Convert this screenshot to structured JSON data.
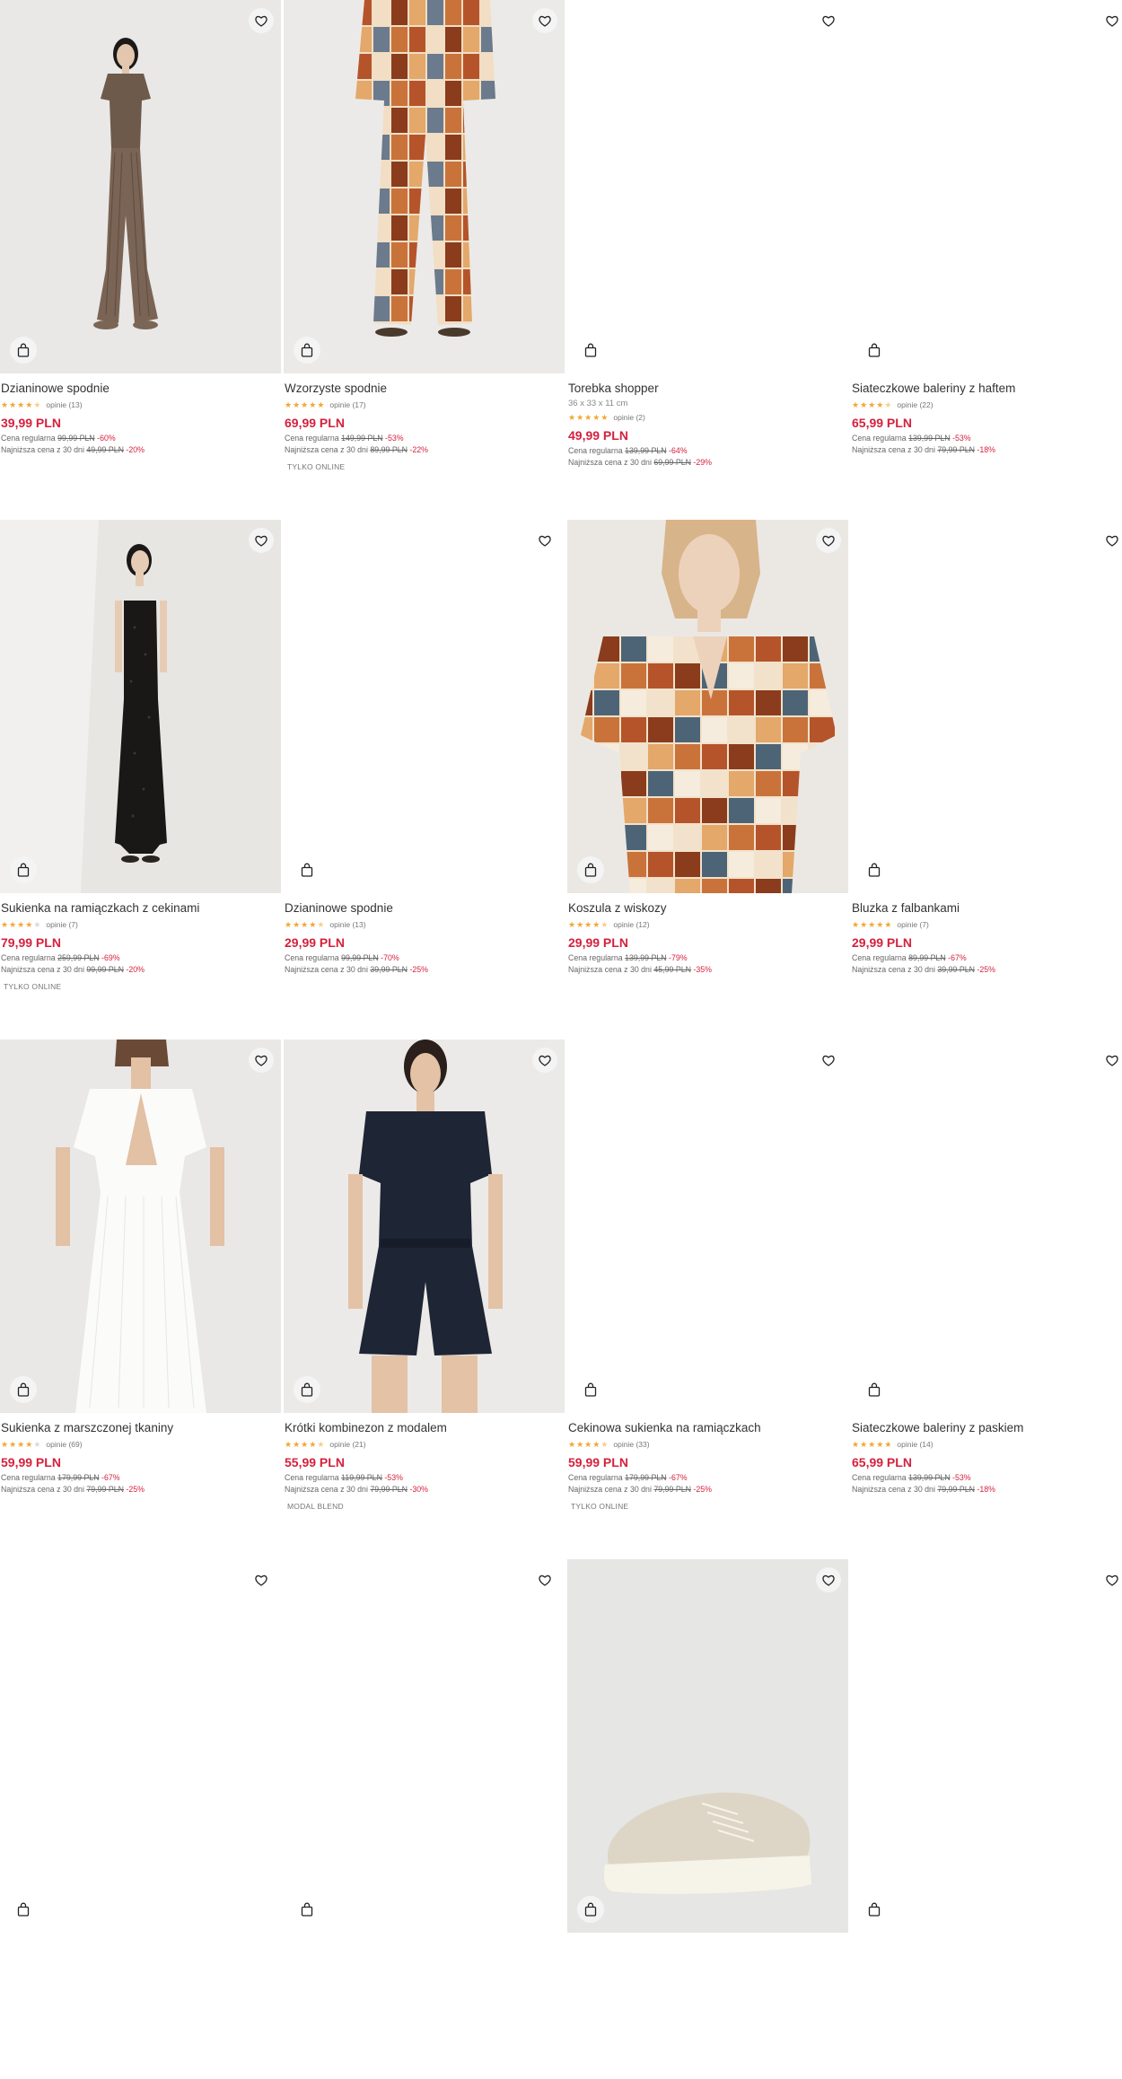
{
  "products": [
    {
      "name": "Dzianinowe spodnie",
      "dims": "",
      "stars": 4.5,
      "reviews": "opinie (13)",
      "price": "39,99 PLN",
      "reg_label": "Cena regularna",
      "reg_price": "99,99 PLN",
      "reg_disc": "-60%",
      "low_label": "Najniższa cena z 30 dni",
      "low_price": "49,99 PLN",
      "low_disc": "-20%",
      "tag": "",
      "image": "knit-brown-outfit",
      "fav_icon": "heart-outline-icon",
      "bag_icon": "shopping-bag-icon"
    },
    {
      "name": "Wzorzyste spodnie",
      "dims": "",
      "stars": 5,
      "reviews": "opinie (17)",
      "price": "69,99 PLN",
      "reg_label": "Cena regularna",
      "reg_price": "149,99 PLN",
      "reg_disc": "-53%",
      "low_label": "Najniższa cena z 30 dni",
      "low_price": "89,99 PLN",
      "low_disc": "-22%",
      "tag": "TYLKO ONLINE",
      "image": "patterned-trousers",
      "fav_icon": "heart-outline-icon",
      "bag_icon": "shopping-bag-icon"
    },
    {
      "name": "Torebka shopper",
      "dims": "36 x 33 x 11 cm",
      "stars": 5,
      "reviews": "opinie (2)",
      "price": "49,99 PLN",
      "reg_label": "Cena regularna",
      "reg_price": "139,99 PLN",
      "reg_disc": "-64%",
      "low_label": "Najniższa cena z 30 dni",
      "low_price": "69,99 PLN",
      "low_disc": "-29%",
      "tag": "",
      "image": "blank",
      "fav_icon": "heart-outline-icon",
      "bag_icon": "shopping-bag-icon"
    },
    {
      "name": "Siateczkowe baleriny z haftem",
      "dims": "",
      "stars": 4.5,
      "reviews": "opinie (22)",
      "price": "65,99 PLN",
      "reg_label": "Cena regularna",
      "reg_price": "139,99 PLN",
      "reg_disc": "-53%",
      "low_label": "Najniższa cena z 30 dni",
      "low_price": "79,99 PLN",
      "low_disc": "-18%",
      "tag": "",
      "image": "blank",
      "fav_icon": "heart-outline-icon",
      "bag_icon": "shopping-bag-icon"
    },
    {
      "name": "Sukienka na ramiączkach z cekinami",
      "dims": "",
      "stars": 4,
      "reviews": "opinie (7)",
      "price": "79,99 PLN",
      "reg_label": "Cena regularna",
      "reg_price": "259,99 PLN",
      "reg_disc": "-69%",
      "low_label": "Najniższa cena z 30 dni",
      "low_price": "99,99 PLN",
      "low_disc": "-20%",
      "tag": "TYLKO ONLINE",
      "image": "black-sequin-dress",
      "fav_icon": "heart-outline-icon",
      "bag_icon": "shopping-bag-icon"
    },
    {
      "name": "Dzianinowe spodnie",
      "dims": "",
      "stars": 4.5,
      "reviews": "opinie (13)",
      "price": "29,99 PLN",
      "reg_label": "Cena regularna",
      "reg_price": "99,99 PLN",
      "reg_disc": "-70%",
      "low_label": "Najniższa cena z 30 dni",
      "low_price": "39,99 PLN",
      "low_disc": "-25%",
      "tag": "",
      "image": "blank",
      "fav_icon": "heart-outline-icon",
      "bag_icon": "shopping-bag-icon"
    },
    {
      "name": "Koszula z wiskozy",
      "dims": "",
      "stars": 4.5,
      "reviews": "opinie (12)",
      "price": "29,99 PLN",
      "reg_label": "Cena regularna",
      "reg_price": "139,99 PLN",
      "reg_disc": "-79%",
      "low_label": "Najniższa cena z 30 dni",
      "low_price": "45,99 PLN",
      "low_disc": "-35%",
      "tag": "",
      "image": "patterned-shirt",
      "fav_icon": "heart-outline-icon",
      "bag_icon": "shopping-bag-icon"
    },
    {
      "name": "Bluzka z falbankami",
      "dims": "",
      "stars": 5,
      "reviews": "opinie (7)",
      "price": "29,99 PLN",
      "reg_label": "Cena regularna",
      "reg_price": "89,99 PLN",
      "reg_disc": "-67%",
      "low_label": "Najniższa cena z 30 dni",
      "low_price": "39,99 PLN",
      "low_disc": "-25%",
      "tag": "",
      "image": "blank",
      "fav_icon": "heart-outline-icon",
      "bag_icon": "shopping-bag-icon"
    },
    {
      "name": "Sukienka z marszczonej tkaniny",
      "dims": "",
      "stars": 4,
      "reviews": "opinie (69)",
      "price": "59,99 PLN",
      "reg_label": "Cena regularna",
      "reg_price": "179,99 PLN",
      "reg_disc": "-67%",
      "low_label": "Najniższa cena z 30 dni",
      "low_price": "79,99 PLN",
      "low_disc": "-25%",
      "tag": "",
      "image": "white-maxi-dress",
      "fav_icon": "heart-outline-icon",
      "bag_icon": "shopping-bag-icon"
    },
    {
      "name": "Krótki kombinezon z modalem",
      "dims": "",
      "stars": 4.5,
      "reviews": "opinie (21)",
      "price": "55,99 PLN",
      "reg_label": "Cena regularna",
      "reg_price": "119,99 PLN",
      "reg_disc": "-53%",
      "low_label": "Najniższa cena z 30 dni",
      "low_price": "79,99 PLN",
      "low_disc": "-30%",
      "tag": "MODAL BLEND",
      "image": "navy-jumpsuit",
      "fav_icon": "heart-outline-icon",
      "bag_icon": "shopping-bag-icon"
    },
    {
      "name": "Cekinowa sukienka na ramiączkach",
      "dims": "",
      "stars": 4.5,
      "reviews": "opinie (33)",
      "price": "59,99 PLN",
      "reg_label": "Cena regularna",
      "reg_price": "179,99 PLN",
      "reg_disc": "-67%",
      "low_label": "Najniższa cena z 30 dni",
      "low_price": "79,99 PLN",
      "low_disc": "-25%",
      "tag": "TYLKO ONLINE",
      "image": "blank",
      "fav_icon": "heart-outline-icon",
      "bag_icon": "shopping-bag-icon"
    },
    {
      "name": "Siateczkowe baleriny z paskiem",
      "dims": "",
      "stars": 5,
      "reviews": "opinie (14)",
      "price": "65,99 PLN",
      "reg_label": "Cena regularna",
      "reg_price": "139,99 PLN",
      "reg_disc": "-53%",
      "low_label": "Najniższa cena z 30 dni",
      "low_price": "79,99 PLN",
      "low_disc": "-18%",
      "tag": "",
      "image": "blank",
      "fav_icon": "heart-outline-icon",
      "bag_icon": "shopping-bag-icon"
    },
    {
      "name": "",
      "dims": "",
      "stars": 0,
      "reviews": "",
      "price": "",
      "reg_label": "",
      "reg_price": "",
      "reg_disc": "",
      "low_label": "",
      "low_price": "",
      "low_disc": "",
      "tag": "",
      "image": "blank",
      "fav_icon": "heart-outline-icon",
      "bag_icon": "shopping-bag-icon"
    },
    {
      "name": "",
      "dims": "",
      "stars": 0,
      "reviews": "",
      "price": "",
      "reg_label": "",
      "reg_price": "",
      "reg_disc": "",
      "low_label": "",
      "low_price": "",
      "low_disc": "",
      "tag": "",
      "image": "blank",
      "fav_icon": "heart-outline-icon",
      "bag_icon": "shopping-bag-icon"
    },
    {
      "name": "",
      "dims": "",
      "stars": 0,
      "reviews": "",
      "price": "",
      "reg_label": "",
      "reg_price": "",
      "reg_disc": "",
      "low_label": "",
      "low_price": "",
      "low_disc": "",
      "tag": "",
      "image": "canvas-sneaker",
      "fav_icon": "heart-outline-icon",
      "bag_icon": "shopping-bag-icon"
    },
    {
      "name": "",
      "dims": "",
      "stars": 0,
      "reviews": "",
      "price": "",
      "reg_label": "",
      "reg_price": "",
      "reg_disc": "",
      "low_label": "",
      "low_price": "",
      "low_disc": "",
      "tag": "",
      "image": "blank",
      "fav_icon": "heart-outline-icon",
      "bag_icon": "shopping-bag-icon"
    }
  ],
  "colors": {
    "price": "#d4213d",
    "star": "#f0a830",
    "text": "#333333",
    "muted": "#777777"
  }
}
